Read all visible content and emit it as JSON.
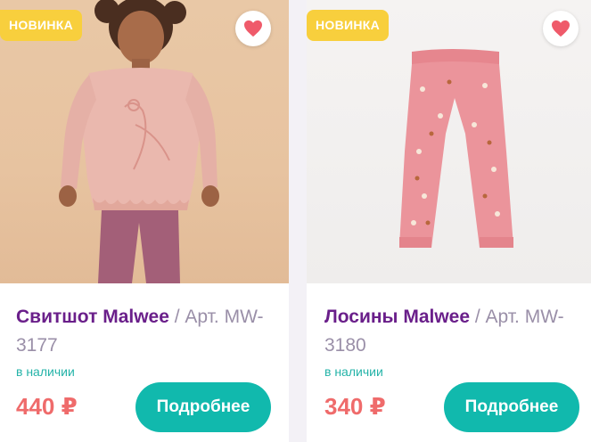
{
  "products": [
    {
      "badge": "НОВИНКА",
      "name": "Свитшот Malwee",
      "art": " / Арт. MW-3177",
      "stock": "в наличии",
      "price": "440 ₽",
      "button": "Подробнее",
      "image": "girl-in-pink-sweatshirt"
    },
    {
      "badge": "НОВИНКА",
      "name": "Лосины Malwee",
      "art": " / Арт. MW-3180",
      "stock": "в наличии",
      "price": "340 ₽",
      "button": "Подробнее",
      "image": "pink-leggings"
    }
  ],
  "colors": {
    "badge": "#f8cf3d",
    "name": "#6a1f8a",
    "stock": "#24b3a8",
    "price": "#ef6b6b",
    "button": "#11b9ad",
    "heart": "#ef5a6a"
  },
  "icons": {
    "favorite": "heart-icon"
  }
}
